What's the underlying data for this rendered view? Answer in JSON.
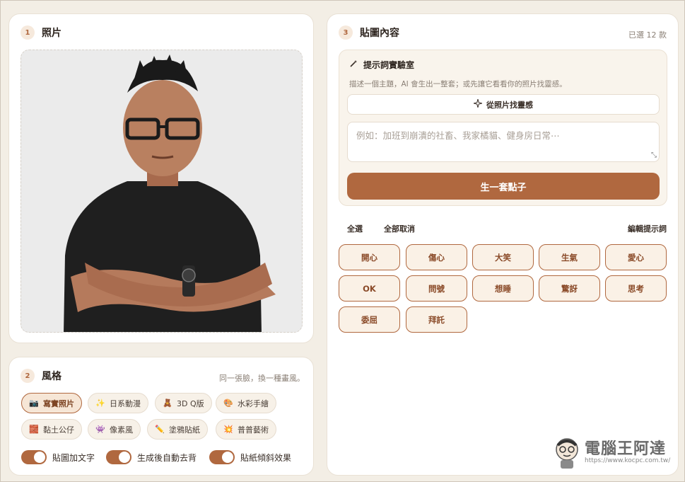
{
  "photo": {
    "step": "1",
    "title": "照片"
  },
  "style": {
    "step": "2",
    "title": "風格",
    "note": "同一張臉，換一種畫風。",
    "chips": [
      {
        "label": "寫實照片",
        "icon": "camera-icon",
        "active": true
      },
      {
        "label": "日系動漫",
        "icon": "sparkle-icon",
        "active": false
      },
      {
        "label": "3D Q版",
        "icon": "bear-icon",
        "active": false
      },
      {
        "label": "水彩手繪",
        "icon": "palette-icon",
        "active": false
      },
      {
        "label": "黏土公仔",
        "icon": "clay-icon",
        "active": false
      },
      {
        "label": "像素風",
        "icon": "pixel-alien-icon",
        "active": false
      },
      {
        "label": "塗鴉貼紙",
        "icon": "pencil-icon",
        "active": false
      },
      {
        "label": "普普藝術",
        "icon": "burst-icon",
        "active": false
      }
    ],
    "toggles": [
      {
        "label": "貼圖加文字",
        "on": true
      },
      {
        "label": "生成後自動去背",
        "on": true
      },
      {
        "label": "貼紙傾斜效果",
        "on": true
      }
    ]
  },
  "content": {
    "step": "3",
    "title": "貼圖內容",
    "selected_count": "已選 12 款",
    "lab": {
      "title": "提示詞實驗室",
      "desc": "描述一個主題，AI 會生出一整套；或先讓它看看你的照片找靈感。",
      "inspire_label": "從照片找靈感",
      "placeholder": "例如：加班到崩潰的社畜、我家橘貓、健身房日常⋯",
      "generate_label": "生一套點子"
    },
    "select_all": "全選",
    "deselect_all": "全部取消",
    "edit_prompts": "編輯提示詞",
    "emotions": [
      "開心",
      "傷心",
      "大笑",
      "生氣",
      "愛心",
      "OK",
      "問號",
      "想睡",
      "驚訝",
      "思考",
      "委屈",
      "拜託"
    ]
  },
  "watermark": {
    "name": "電腦王阿達",
    "url": "https://www.kocpc.com.tw/"
  },
  "colors": {
    "accent": "#b0683f",
    "background": "#f3eee5",
    "card": "#ffffff"
  }
}
